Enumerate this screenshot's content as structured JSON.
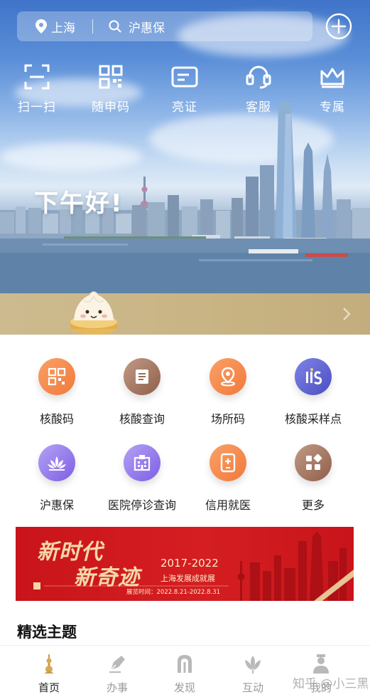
{
  "search_bar": {
    "location": "上海",
    "query": "沪惠保"
  },
  "quick_actions": [
    {
      "label": "扫一扫",
      "icon": "scan-icon"
    },
    {
      "label": "随申码",
      "icon": "qr-code-icon"
    },
    {
      "label": "亮证",
      "icon": "id-card-icon"
    },
    {
      "label": "客服",
      "icon": "headset-icon"
    },
    {
      "label": "专属",
      "icon": "crown-icon"
    }
  ],
  "greeting": "下午好!",
  "services": [
    {
      "label": "核酸码",
      "icon": "qr-code-icon",
      "color": "#f07a3c"
    },
    {
      "label": "核酸查询",
      "icon": "document-icon",
      "color": "#9b6b55"
    },
    {
      "label": "场所码",
      "icon": "location-pin-icon",
      "color": "#f07a3c"
    },
    {
      "label": "核酸采样点",
      "icon": "sampling-point-icon",
      "color": "#5b5fd0"
    },
    {
      "label": "沪惠保",
      "icon": "lotus-icon",
      "color": "#8a6ee8"
    },
    {
      "label": "医院停诊查询",
      "icon": "hospital-icon",
      "color": "#8a6ee8"
    },
    {
      "label": "信用就医",
      "icon": "medical-phone-icon",
      "color": "#f07a3c"
    },
    {
      "label": "更多",
      "icon": "more-grid-icon",
      "color": "#9b6b55"
    }
  ],
  "banner": {
    "title_line1": "新时代",
    "title_line2": "新奇迹",
    "years": "2017-2022",
    "subtitle": "上海发展成就展",
    "date_text": "展览时间：2022.8.21-2022.8.31"
  },
  "section_title": "精选主题",
  "tabs": [
    {
      "label": "首页",
      "icon": "home-tower-icon",
      "active": true
    },
    {
      "label": "办事",
      "icon": "pen-icon",
      "active": false
    },
    {
      "label": "发现",
      "icon": "arch-icon",
      "active": false
    },
    {
      "label": "互动",
      "icon": "magnolia-icon",
      "active": false
    },
    {
      "label": "我的",
      "icon": "user-icon",
      "active": false
    }
  ],
  "watermark": "知乎 @小三黑",
  "colors": {
    "accent_orange": "#f07a3c",
    "accent_brown": "#9b6b55",
    "accent_purple": "#8a6ee8",
    "accent_indigo": "#5b5fd0",
    "banner_red": "#d41e22",
    "strip_tan": "#c8b383"
  }
}
